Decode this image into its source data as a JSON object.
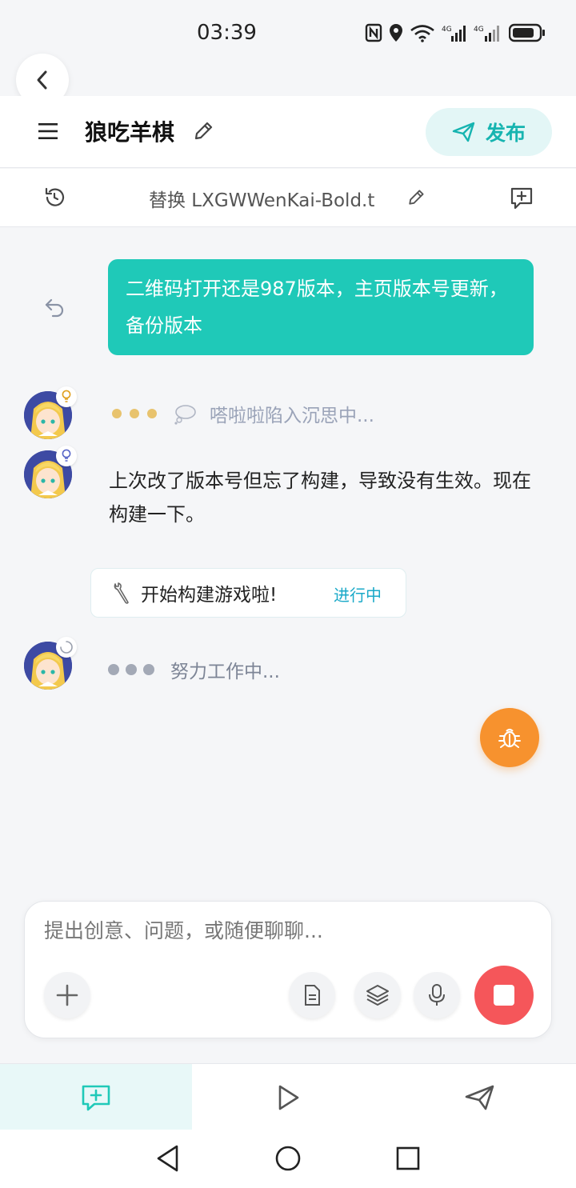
{
  "status_bar": {
    "time": "03:39"
  },
  "header": {
    "title": "狼吃羊棋",
    "publish_label": "发布"
  },
  "subheader": {
    "text": "替换 LXGWWenKai-Bold.t"
  },
  "messages": {
    "user_message": "二维码打开还是987版本，主页版本号更新，备份版本",
    "thinking_text": "嗒啦啦陷入沉思中...",
    "bot_reply": "上次改了版本号但忘了构建，导致没有生效。现在构建一下。",
    "task_label": "开始构建游戏啦!",
    "task_status": "进行中",
    "working_text": "努力工作中..."
  },
  "composer": {
    "placeholder": "提出创意、问题，或随便聊聊..."
  },
  "colors": {
    "accent": "#1fc9b8",
    "publish_text": "#16b4b0",
    "bug_fab": "#f7922e",
    "stop": "#f5565a",
    "task_status": "#1aa9c8"
  },
  "icons": {
    "back": "chevron-left-icon",
    "menu": "hamburger-menu-icon",
    "edit": "pencil-icon",
    "publish": "send-icon",
    "history": "history-icon",
    "new_chat": "chat-plus-icon",
    "undo": "undo-icon",
    "bug": "bug-icon",
    "add": "plus-icon",
    "file": "document-icon",
    "layers": "layers-icon",
    "mic": "microphone-icon",
    "stop": "stop-icon",
    "tab_chat": "chat-plus-icon",
    "tab_play": "play-icon",
    "tab_send": "send-icon"
  }
}
